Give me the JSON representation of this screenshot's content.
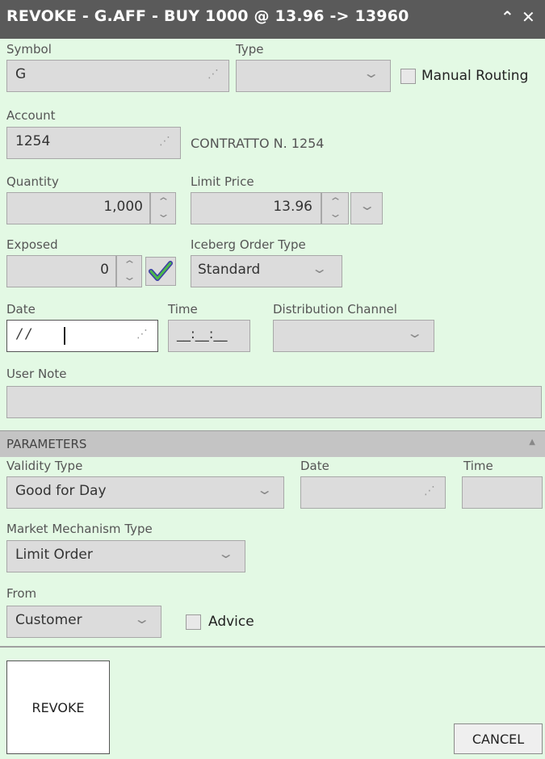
{
  "window": {
    "title": "REVOKE - G.AFF - BUY 1000 @ 13.96 -> 13960"
  },
  "order": {
    "symbol_label": "Symbol",
    "symbol_value": "G",
    "type_label": "Type",
    "type_value": "",
    "manual_routing_label": "Manual Routing",
    "account_label": "Account",
    "account_value": "1254",
    "account_desc": "CONTRATTO N. 1254",
    "quantity_label": "Quantity",
    "quantity_value": "1,000",
    "limit_price_label": "Limit Price",
    "limit_price_value": "13.96",
    "exposed_label": "Exposed",
    "exposed_value": "0",
    "iceberg_label": "Iceberg Order Type",
    "iceberg_value": "Standard",
    "date_label": "Date",
    "date_value": "/ /",
    "time_label": "Time",
    "time_value": "__:__:__",
    "distribution_label": "Distribution Channel",
    "distribution_value": "",
    "user_note_label": "User Note",
    "user_note_value": ""
  },
  "parameters": {
    "header": "PARAMETERS",
    "validity_type_label": "Validity Type",
    "validity_type_value": "Good for Day",
    "date_label": "Date",
    "date_value": "",
    "time_label": "Time",
    "time_value": "",
    "market_mech_label": "Market Mechanism Type",
    "market_mech_value": "Limit Order",
    "from_label": "From",
    "from_value": "Customer",
    "advice_label": "Advice"
  },
  "actions": {
    "revoke_label": "REVOKE",
    "cancel_label": "CANCEL"
  },
  "colors": {
    "background": "#e3f9e4",
    "titlebar": "#5a5a5a",
    "field": "#dcdcdc",
    "section": "#c4c4c4"
  }
}
